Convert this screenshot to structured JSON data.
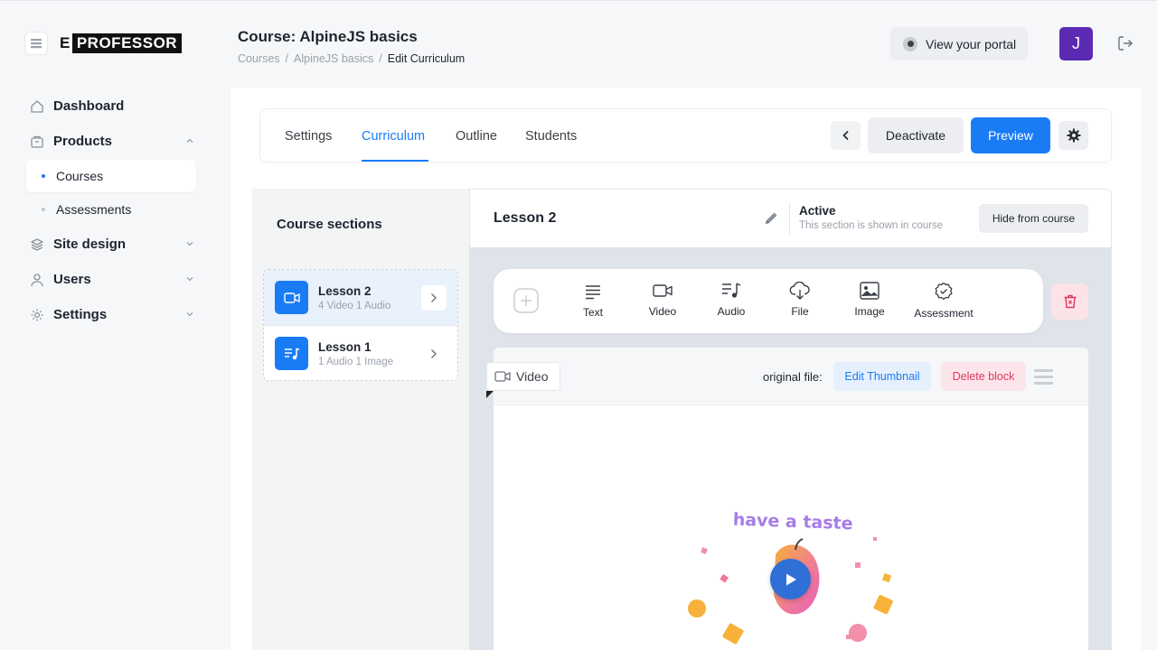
{
  "brand": {
    "prefix": "E",
    "name": "PROFESSOR"
  },
  "sidebar": {
    "items": [
      {
        "label": "Dashboard",
        "icon": "home-icon"
      },
      {
        "label": "Products",
        "icon": "box-icon",
        "expanded": true,
        "children": [
          {
            "label": "Courses",
            "active": true
          },
          {
            "label": "Assessments",
            "active": false
          }
        ]
      },
      {
        "label": "Site design",
        "icon": "layers-icon"
      },
      {
        "label": "Users",
        "icon": "user-icon"
      },
      {
        "label": "Settings",
        "icon": "gear-icon"
      }
    ]
  },
  "header": {
    "title": "Course: AlpineJS basics",
    "breadcrumbs": [
      "Courses",
      "AlpineJS basics",
      "Edit Curriculum"
    ],
    "breadcrumb_separator": "/",
    "portal_button": "View your portal",
    "avatar_initial": "J",
    "avatar_color": "#5b2ab3"
  },
  "tabs": {
    "items": [
      "Settings",
      "Curriculum",
      "Outline",
      "Students"
    ],
    "active": "Curriculum",
    "deactivate": "Deactivate",
    "preview": "Preview"
  },
  "sections": {
    "title": "Course sections",
    "lessons": [
      {
        "name": "Lesson 2",
        "meta": "4 Video 1 Audio",
        "icon": "video-icon",
        "selected": true
      },
      {
        "name": "Lesson 1",
        "meta": "1 Audio 1 Image",
        "icon": "music-icon",
        "selected": false
      }
    ]
  },
  "editor": {
    "lesson_title": "Lesson 2",
    "status": "Active",
    "status_desc": "This section is shown in course",
    "hide_button": "Hide from course",
    "tools": [
      "Text",
      "Video",
      "Audio",
      "File",
      "Image",
      "Assessment"
    ],
    "block": {
      "type_label": "Video",
      "original_file_label": "original file:",
      "edit_thumbnail": "Edit Thumbnail",
      "delete_block": "Delete block",
      "thumbnail_text": "have a taste"
    }
  },
  "colors": {
    "accent": "#1a7cf5",
    "danger": "#e2375e",
    "brand_dark": "#111111"
  }
}
